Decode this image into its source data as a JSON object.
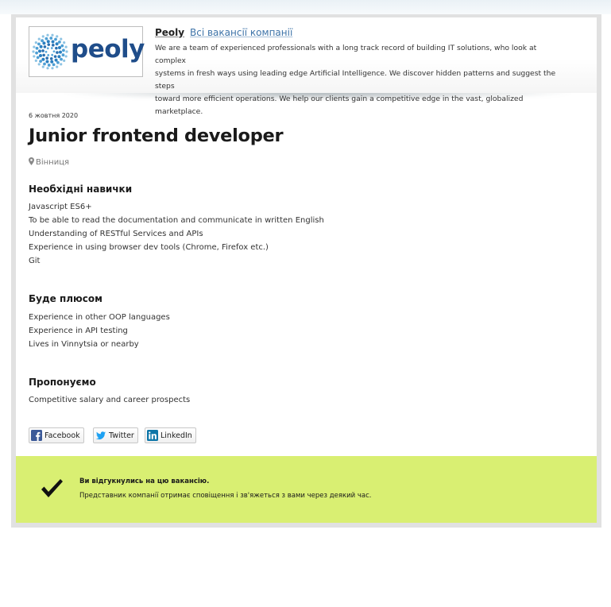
{
  "company": {
    "logo_text": "peoly",
    "name": "Peoly",
    "all_jobs_link": "Всі вакансії компанії",
    "description_lines": [
      "We are a team of experienced professionals with a long track record of building IT solutions, who look at complex",
      "systems in fresh ways using leading edge Artificial Intelligence. We discover hidden patterns and suggest the steps",
      "toward more efficient operations. We help our clients gain a competitive edge in the vast, globalized marketplace."
    ]
  },
  "vacancy": {
    "date": "6 жовтня 2020",
    "title": "Junior frontend developer",
    "location": "Вінниця",
    "sections": {
      "required": {
        "heading": "Необхідні навички",
        "items": [
          "Javascript ES6+",
          "To be able to read the documentation and communicate in written English",
          "Understanding of RESTful Services and APIs",
          "Experience in using browser dev tools (Chrome, Firefox etc.)",
          "Git"
        ]
      },
      "plus": {
        "heading": "Буде плюсом",
        "items": [
          "Experience in other OOP languages",
          "Experience in API testing",
          "Lives in Vinnytsia or nearby"
        ]
      },
      "offer": {
        "heading": "Пропонуємо",
        "items": [
          "Competitive salary and career prospects"
        ]
      }
    }
  },
  "share": {
    "facebook": "Facebook",
    "twitter": "Twitter",
    "linkedin": "LinkedIn"
  },
  "applied": {
    "title": "Ви відгукнулись на цю вакансію.",
    "text": "Представник компанії отримає сповіщення і зв'яжеться з вами через деякий час."
  },
  "colors": {
    "brand_blue": "#1f4d8a",
    "link_blue": "#3d73a8",
    "applied_banner": "#d9ef72",
    "facebook": "#3b5998",
    "twitter": "#1da1f2",
    "linkedin": "#0e76a8"
  },
  "icons": [
    "peoly-logo-dots",
    "location-pin-icon",
    "facebook-icon",
    "twitter-icon",
    "linkedin-icon",
    "checkmark-icon"
  ]
}
